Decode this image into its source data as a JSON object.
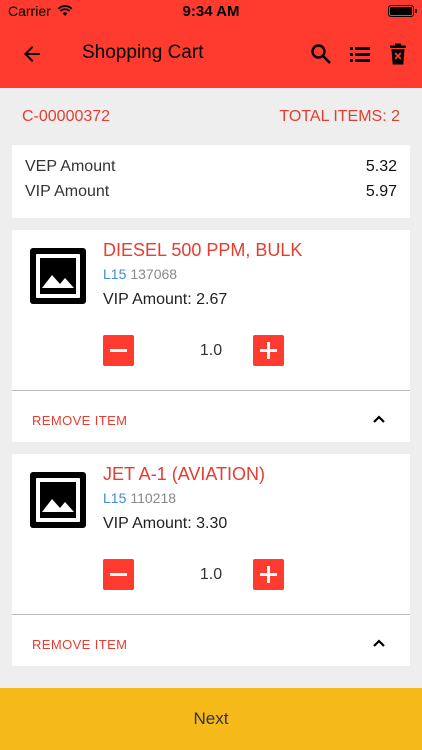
{
  "status_bar": {
    "carrier": "Carrier",
    "time": "9:34 AM"
  },
  "app_bar": {
    "title": "Shopping Cart"
  },
  "cart": {
    "id": "C-00000372",
    "total_items_label": "TOTAL ITEMS: 2"
  },
  "amounts": [
    {
      "label": "VEP Amount",
      "value": "5.32"
    },
    {
      "label": "VIP Amount",
      "value": "5.97"
    }
  ],
  "items": [
    {
      "name": "DIESEL 500 PPM, BULK",
      "level": "L15",
      "code": "137068",
      "vip": "VIP Amount: 2.67",
      "qty": "1.0",
      "remove_label": "REMOVE ITEM"
    },
    {
      "name": "JET A-1 (AVIATION)",
      "level": "L15",
      "code": "110218",
      "vip": "VIP Amount: 3.30",
      "qty": "1.0",
      "remove_label": "REMOVE ITEM"
    }
  ],
  "footer": {
    "next_label": "Next"
  },
  "colors": {
    "primary": "#ff3b2f",
    "accent_text": "#e53d2f",
    "footer": "#f5b91a",
    "level": "#3b8fd6"
  }
}
